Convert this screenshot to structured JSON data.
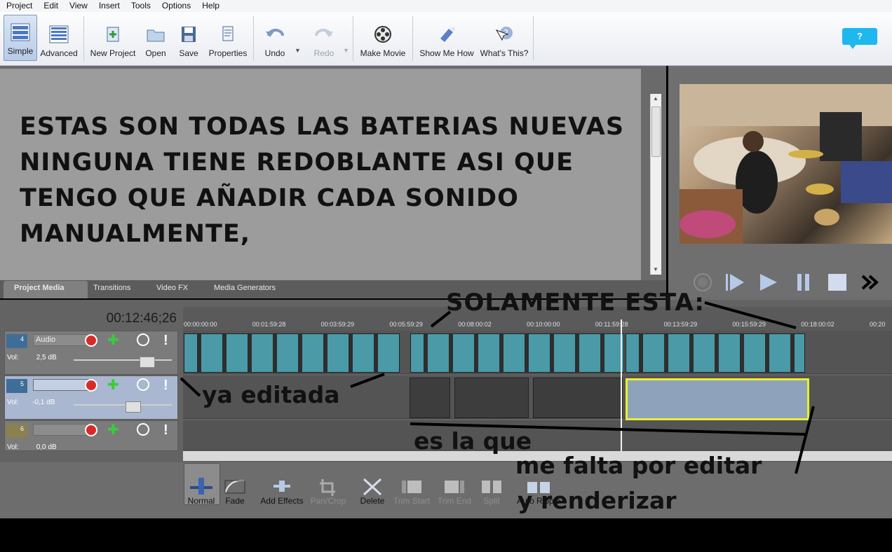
{
  "menu": [
    "Project",
    "Edit",
    "View",
    "Insert",
    "Tools",
    "Options",
    "Help"
  ],
  "toolbar": {
    "simple": "Simple",
    "advanced": "Advanced",
    "new_project": "New Project",
    "open": "Open",
    "save": "Save",
    "properties": "Properties",
    "undo": "Undo",
    "redo": "Redo",
    "make_movie": "Make Movie",
    "show_me_how": "Show Me How",
    "whats_this": "What's This?",
    "help_bubble": "?"
  },
  "overlay_text": [
    "ESTAS SON TODAS LAS BATERIAS NUEVAS",
    "NINGUNA TIENE REDOBLANTE ASI QUE",
    "TENGO QUE AÑADIR CADA SONIDO",
    "MANUALMENTE,"
  ],
  "tabs": [
    "Project Media",
    "Transitions",
    "Video FX",
    "Media Generators"
  ],
  "timeline": {
    "timecode": "00:12:46;26",
    "ticks": [
      "00:00:00:00",
      "00:01:59:28",
      "00:03:59:29",
      "00:05:59:29",
      "00:08:00:02",
      "00:10:00:00",
      "00:11:59:28",
      "00:13:59:29",
      "00:15:59:29",
      "00:18:00:02",
      "00:20"
    ],
    "tracks": [
      {
        "num": "4",
        "name": "Audio",
        "vol_label": "Vol:",
        "vol": "2,5 dB"
      },
      {
        "num": "5",
        "name": "",
        "vol_label": "Vol:",
        "vol": "-0,1 dB"
      },
      {
        "num": "6",
        "name": "",
        "vol_label": "Vol:",
        "vol": "0,0 dB"
      }
    ]
  },
  "bottom_toolbar": {
    "normal": "Normal",
    "fade": "Fade",
    "add_effects": "Add Effects",
    "pan_crop": "Pan/Crop",
    "delete": "Delete",
    "trim_start": "Trim Start",
    "trim_end": "Trim End",
    "split": "Split",
    "auto_ripple": "Auto Ripple"
  },
  "annotations": {
    "solamente": "SOLAMENTE ESTA:",
    "ya_editada": "ya editada",
    "es_la_que": "es la que",
    "me_falta": "me falta por editar",
    "renderizar": "y renderizar"
  },
  "colors": {
    "accent": "#1eb7ee",
    "clip": "#4a9aa8",
    "highlight": "#e9ef2c"
  }
}
